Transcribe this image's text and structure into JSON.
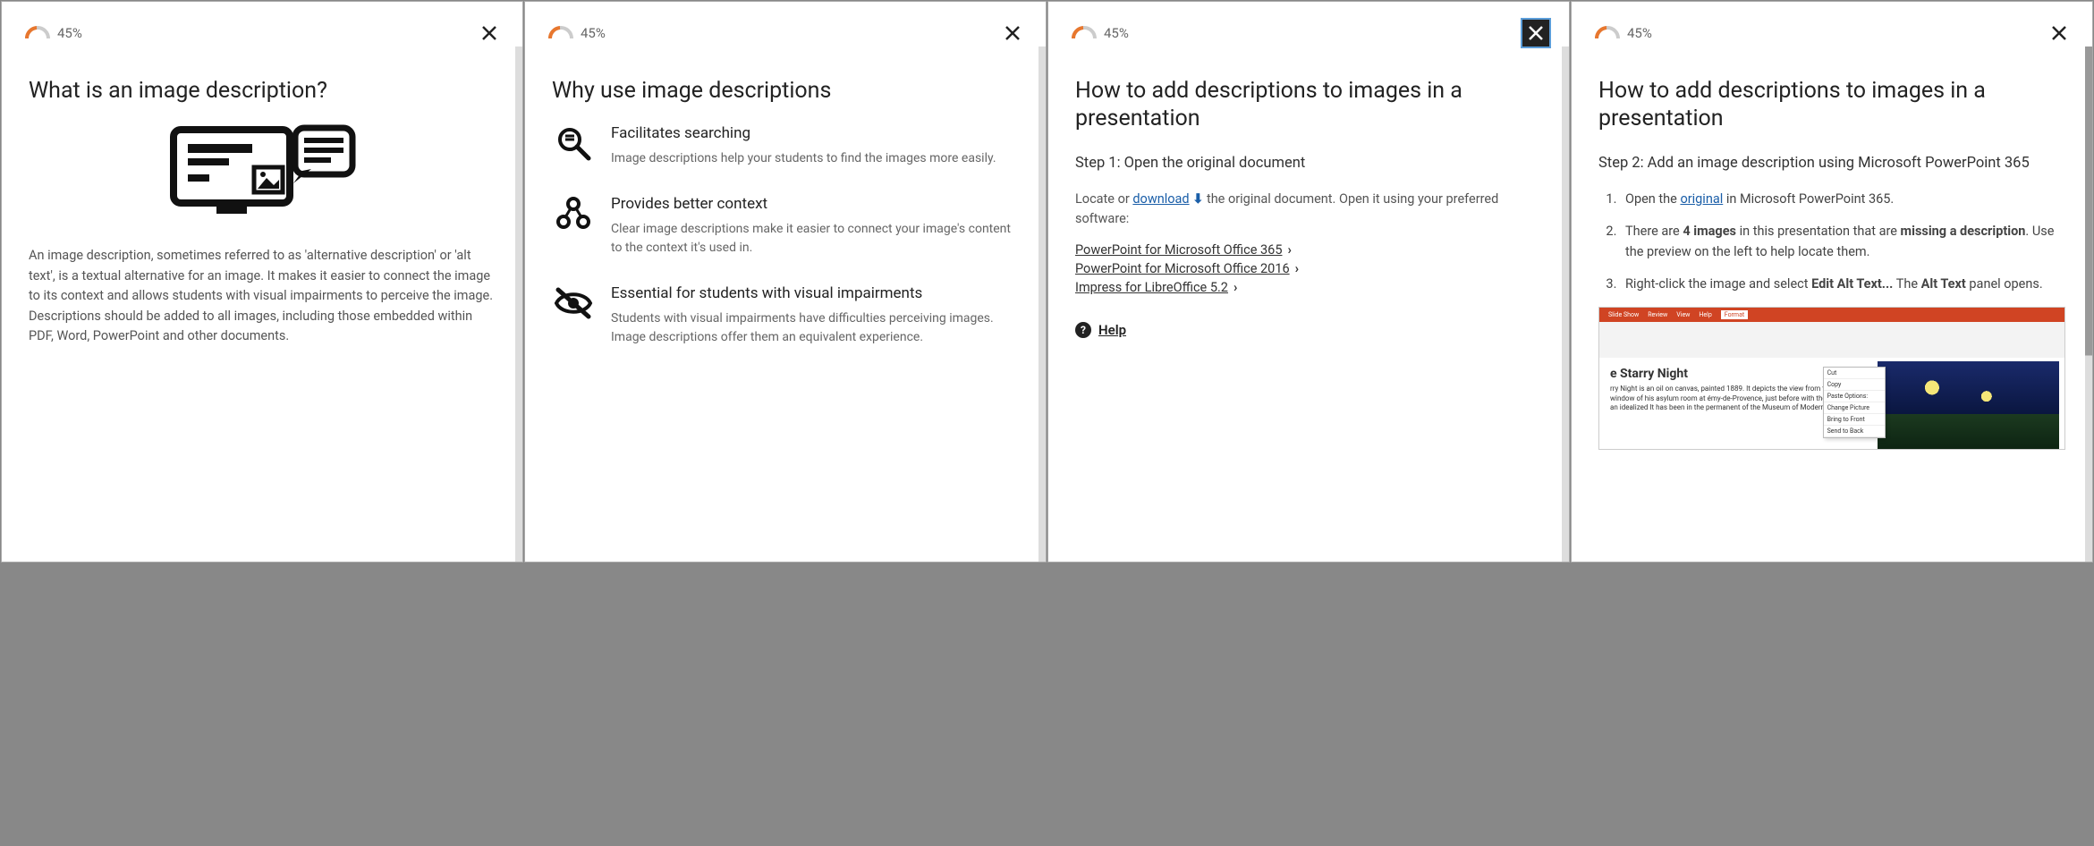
{
  "gauge_percent": "45%",
  "panels": [
    {
      "title": "What is an image description?",
      "body": "An image description, sometimes referred to as 'alternative description' or 'alt text', is a textual alternative for an image. It makes it easier to connect the image to its context and allows students with visual impairments to perceive the image. Descriptions should be added to all images, including those embedded within PDF, Word, PowerPoint and other documents."
    },
    {
      "title": "Why use image descriptions",
      "features": [
        {
          "heading": "Facilitates searching",
          "text": "Image descriptions help your students to find the images more easily."
        },
        {
          "heading": "Provides better context",
          "text": "Clear image descriptions make it easier to connect your image's content to the context it's used in."
        },
        {
          "heading": "Essential for students with visual impairments",
          "text": "Students with visual impairments have difficulties perceiving images. Image descriptions offer them an equivalent experience."
        }
      ]
    },
    {
      "title": "How to add descriptions to images in a presentation",
      "step_label": "Step 1: Open the original document",
      "sentence_pre": "Locate or ",
      "download_label": "download",
      "sentence_post": " the original document. Open it using your preferred software:",
      "software": [
        "PowerPoint for Microsoft Office 365",
        "PowerPoint for Microsoft Office 2016",
        "Impress for LibreOffice 5.2"
      ],
      "help_label": "Help"
    },
    {
      "title": "How to add descriptions to images in a presentation",
      "step_label": "Step 2: Add an image description using Microsoft PowerPoint 365",
      "list": {
        "item1_pre": "Open the ",
        "item1_link": "original",
        "item1_post": " in Microsoft PowerPoint 365.",
        "item2_pre": "There are ",
        "item2_bold1": "4 images",
        "item2_mid": " in this presentation that are ",
        "item2_bold2": "missing a description",
        "item2_post": ". Use the preview on the left to help locate them.",
        "item3_pre": "Right-click the image and select ",
        "item3_bold1": "Edit Alt Text...",
        "item3_mid": " The ",
        "item3_bold2": "Alt Text",
        "item3_post": " panel opens."
      },
      "screenshot": {
        "tabs": [
          "Slide Show",
          "Review",
          "View",
          "Help",
          "Format"
        ],
        "doc_title": "e Starry Night",
        "doc_snippet": "rry Night is an oil on canvas, painted 1889. It depicts the view from the ing window of his asylum room at émy-de-Provence, just before with the addition of an idealized It has been in the permanent of the Museum of Modern Art in",
        "menu": [
          "Cut",
          "Copy",
          "Paste Options:",
          "Change Picture",
          "Bring to Front",
          "Send to Back"
        ]
      }
    }
  ]
}
